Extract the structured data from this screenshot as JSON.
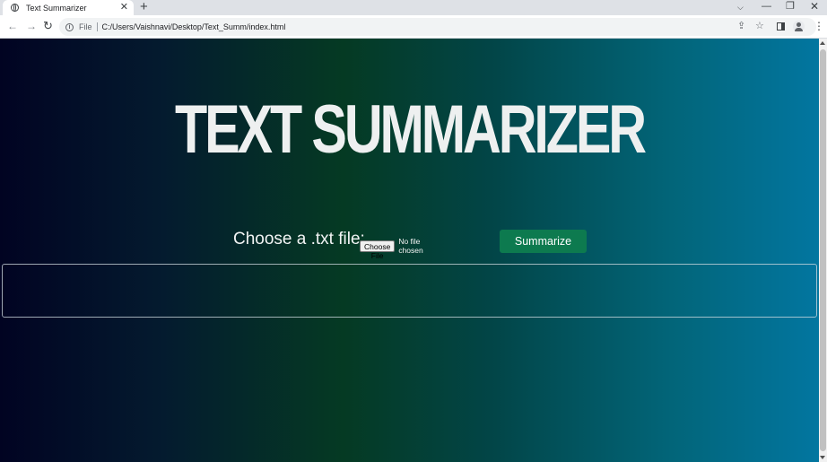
{
  "browser": {
    "tab": {
      "title": "Text Summarizer"
    },
    "new_tab_symbol": "+",
    "tab_close_symbol": "✕",
    "window_controls": {
      "tab_search": "⌵",
      "minimize": "—",
      "restore": "❐",
      "close": "✕"
    },
    "address_bar": {
      "scheme_label": "File",
      "url": "C:/Users/Vaishnavi/Desktop/Text_Summ/index.html"
    },
    "nav_symbols": {
      "back": "←",
      "forward": "→",
      "reload": "↻",
      "share": "⇪",
      "star": "☆",
      "menu": "⋮"
    }
  },
  "page": {
    "title": "TEXT SUMMARIZER",
    "upload": {
      "label": "Choose a .txt file:",
      "button_label": "Choose File",
      "status": "No file chosen"
    },
    "summarize_button": "Summarize",
    "output": ""
  },
  "colors": {
    "gradient": [
      "#010322",
      "#053a23",
      "#0276a0"
    ],
    "summarize_button": "#0d7a4f"
  }
}
